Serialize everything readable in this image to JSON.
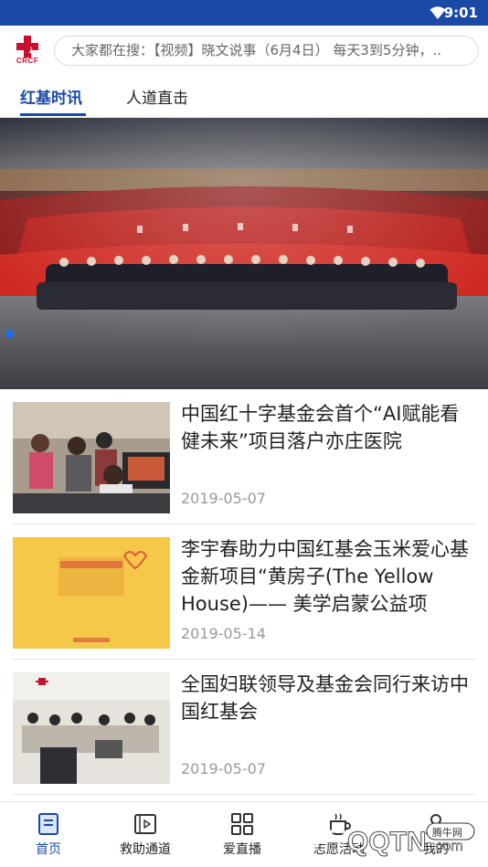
{
  "status_bar": {
    "time": "9:01",
    "icons": [
      "wifi-icon",
      "signal-icon"
    ]
  },
  "header": {
    "logo_text": "CRCF",
    "search_placeholder": "大家都在搜：【视频】晓文说事（6月4日） 每天3到5分钟，.."
  },
  "tabs": [
    {
      "label": "红基时讯",
      "active": true
    },
    {
      "label": "人道直击",
      "active": false
    }
  ],
  "banner": {
    "slide_index": 1
  },
  "news": [
    {
      "title": "中国红十字基金会首个“AI赋能看健未来”项目落户亦庄医院",
      "date": "2019-05-07"
    },
    {
      "title": "李宇春助力中国红基会玉米爱心基金新项目“黄房子(The Yellow House)—— 美学启蒙公益项目”启",
      "date": "2019-05-14"
    },
    {
      "title": "全国妇联领导及基金会同行来访中国红基会",
      "date": "2019-05-07"
    }
  ],
  "bottom_nav": [
    {
      "label": "首页",
      "icon": "home-icon",
      "active": true
    },
    {
      "label": "救助通道",
      "icon": "video-icon",
      "active": false
    },
    {
      "label": "爱直播",
      "icon": "grid-icon",
      "active": false
    },
    {
      "label": "志愿活动",
      "icon": "cup-icon",
      "active": false
    },
    {
      "label": "我的",
      "icon": "user-icon",
      "active": false
    }
  ],
  "watermark": {
    "text_top": "腾牛网",
    "text_main": "QQTN",
    "text_suffix": ".com"
  },
  "colors": {
    "brand": "#1a4aa6",
    "red": "#c8102e"
  }
}
